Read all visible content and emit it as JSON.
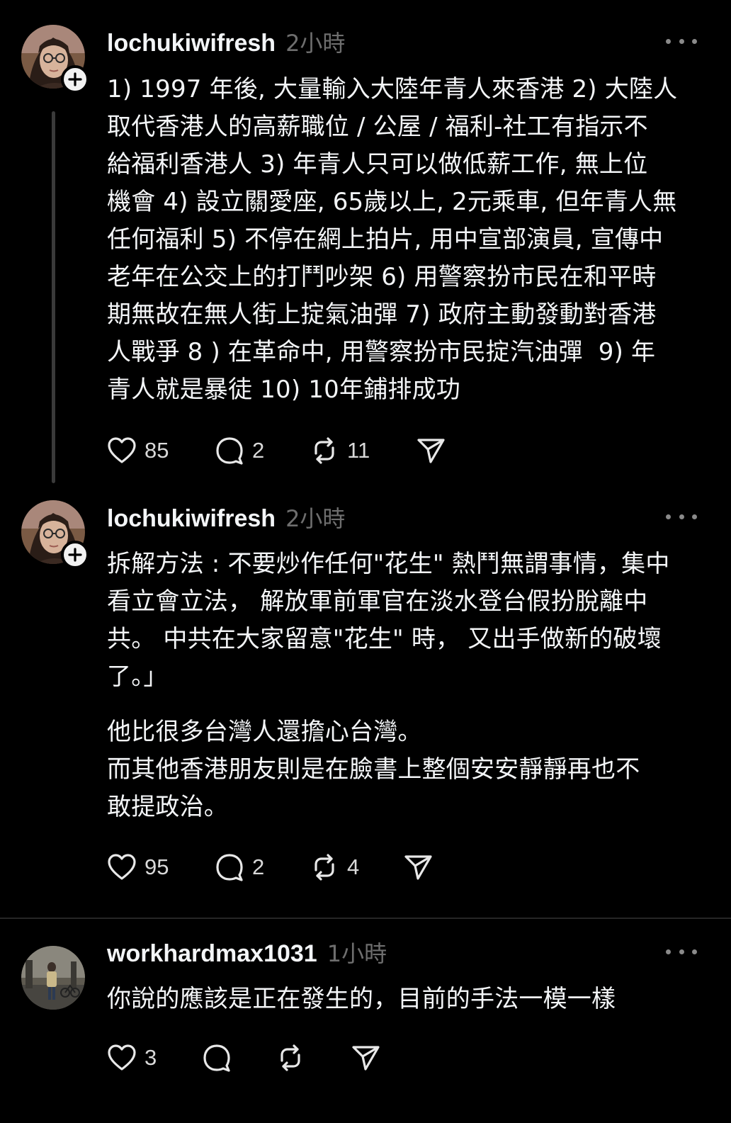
{
  "posts": [
    {
      "username": "lochukiwifresh",
      "time": "2小時",
      "avatar_icon": "woman-glasses-avatar",
      "text": "1) 1997 年後, 大量輸入大陸年青人來香港 2) 大陸人\n取代香港人的高薪職位 / 公屋 / 福利-社工有指示不\n給福利香港人 3) 年青人只可以做低薪工作, 無上位\n機會 4) 設立關愛座, 65歲以上, 2元乘車, 但年青人無\n任何福利 5) 不停在網上拍片, 用中宣部演員, 宣傳中\n老年在公交上的打鬥吵架 6) 用警察扮市民在和平時\n期無故在無人街上掟氣油彈 7) 政府主動發動對香港\n人戰爭 8 ) 在革命中, 用警察扮市民掟汽油彈  9) 年\n青人就是暴徒 10) 10年鋪排成功",
      "likes": "85",
      "replies": "2",
      "reposts": "11"
    },
    {
      "username": "lochukiwifresh",
      "time": "2小時",
      "avatar_icon": "woman-glasses-avatar",
      "text": "拆解方法 : 不要炒作任何\"花生\" 熱鬥無謂事情，集中\n看立會立法， 解放軍前軍官在淡水登台假扮脫離中\n共。 中共在大家留意\"花生\" 時， 又出手做新的破壞\n了。」",
      "text2": "他比很多台灣人還擔心台灣。\n而其他香港朋友則是在臉書上整個安安靜靜再也不\n敢提政治。",
      "likes": "95",
      "replies": "2",
      "reposts": "4"
    },
    {
      "username": "workhardmax1031",
      "time": "1小時",
      "avatar_icon": "street-photo-avatar",
      "text": "你說的應該是正在發生的，目前的手法一模一樣",
      "likes": "3"
    }
  ],
  "icons": {
    "like": "heart-icon",
    "reply": "comment-icon",
    "repost": "repost-icon",
    "share": "send-icon",
    "more": "more-options-icon",
    "follow": "plus-icon"
  },
  "colors": {
    "background": "#000000",
    "text": "#f3f5f7",
    "muted": "#6e6e6e",
    "thread_line": "#3a3a3a"
  }
}
